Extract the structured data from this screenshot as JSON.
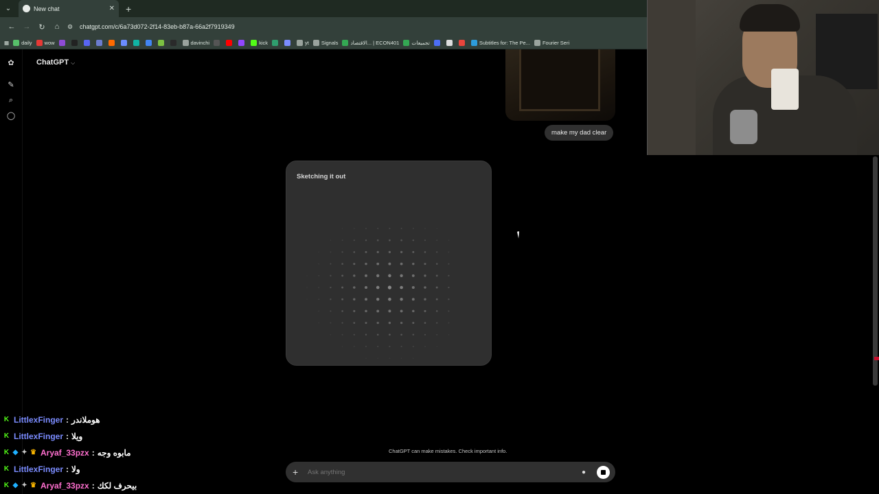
{
  "browser": {
    "tab_title": "New chat",
    "tab_close": "✕",
    "new_tab": "+",
    "tab_menu": "⌄",
    "url": "chatgpt.com/c/6a73d072-2f14-83eb-b87a-66a2f7919349",
    "bookmarks": [
      {
        "label": "daily",
        "color": "#57c06a"
      },
      {
        "label": "wow",
        "color": "#e53935"
      },
      {
        "label": "",
        "color": "#8e4bd6"
      },
      {
        "label": "",
        "color": "#222222"
      },
      {
        "label": "",
        "color": "#5865f2"
      },
      {
        "label": "",
        "color": "#6b7ccf"
      },
      {
        "label": "",
        "color": "#ff6a00"
      },
      {
        "label": "",
        "color": "#6b8cff"
      },
      {
        "label": "",
        "color": "#10b3a3"
      },
      {
        "label": "",
        "color": "#4285f4"
      },
      {
        "label": "",
        "color": "#7cc142"
      },
      {
        "label": "",
        "color": "#2a2a2a"
      },
      {
        "label": "davinchi",
        "color": "#9aa39d"
      },
      {
        "label": "",
        "color": "#555555"
      },
      {
        "label": "",
        "color": "#ff0000"
      },
      {
        "label": "",
        "color": "#9146ff"
      },
      {
        "label": "kick",
        "color": "#53fc18"
      },
      {
        "label": "",
        "color": "#2f9e6e"
      },
      {
        "label": "",
        "color": "#7b8cff"
      },
      {
        "label": "yt",
        "color": "#9aa39d"
      },
      {
        "label": "Signals",
        "color": "#9aa39d"
      },
      {
        "label": "الاقتصاد... | ECON401",
        "color": "#34a853"
      },
      {
        "label": "تجميعات",
        "color": "#34a853"
      },
      {
        "label": "",
        "color": "#4c6ef5"
      },
      {
        "label": "",
        "color": "#dddddd"
      },
      {
        "label": "",
        "color": "#e8453c"
      },
      {
        "label": "Subtitles for: The Pe...",
        "color": "#2d9cdb"
      },
      {
        "label": "Fourier Seri",
        "color": "#9aa39d"
      }
    ]
  },
  "app": {
    "brand": "ChatGPT",
    "brand_chevron": "⌵",
    "user_message": "make my dad clear",
    "sketch_label": "Sketching it out",
    "disclaimer": "ChatGPT can make mistakes. Check important info.",
    "composer_placeholder": "Ask anything",
    "composer_plus": "+",
    "mic_icon": "🎙"
  },
  "stream_chat": [
    {
      "user": "LittlexFinger",
      "user_color": "#7b8cff",
      "badges": [
        "kick"
      ],
      "message": "هوملاندر"
    },
    {
      "user": "LittlexFinger",
      "user_color": "#7b8cff",
      "badges": [
        "kick"
      ],
      "message": "ويلا"
    },
    {
      "user": "Aryaf_33pzx",
      "user_color": "#ff6fcf",
      "badges": [
        "kick",
        "blue",
        "gray",
        "gold"
      ],
      "message": "مابوه وجه"
    },
    {
      "user": "LittlexFinger",
      "user_color": "#7b8cff",
      "badges": [
        "kick"
      ],
      "message": "ولا"
    },
    {
      "user": "Aryaf_33pzx",
      "user_color": "#ff6fcf",
      "badges": [
        "kick",
        "blue",
        "gray",
        "gold"
      ],
      "message": "بيحرف لكك"
    }
  ]
}
